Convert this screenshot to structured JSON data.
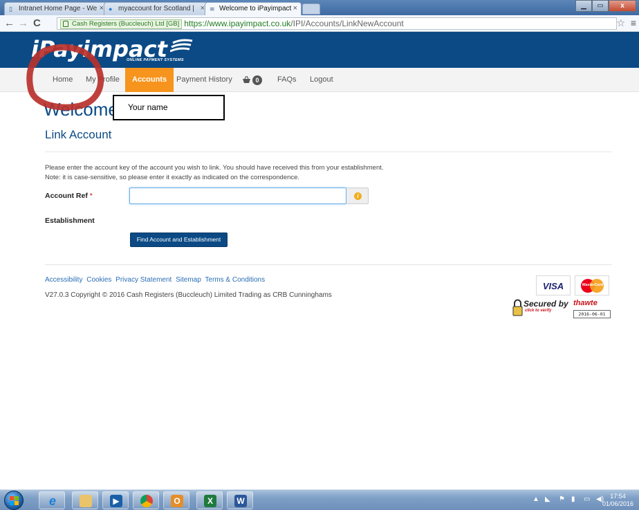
{
  "browser": {
    "tabs": [
      {
        "title": "Intranet Home Page - We",
        "close": "×"
      },
      {
        "title": "myaccount for Scotland |",
        "close": "×"
      },
      {
        "title": "Welcome to iPayimpact",
        "close": "×"
      }
    ],
    "cert_label": "Cash Registers (Buccleuch) Ltd [GB]",
    "url_host": "https://www.ipayimpact.co.uk",
    "url_path": "/IPI/Accounts/LinkNewAccount",
    "window_buttons": [
      "▁",
      "▭",
      "x"
    ]
  },
  "site": {
    "logo": "iPayimpact",
    "logo_sub": "ONLINE PAYMENT SYSTEMS"
  },
  "nav": {
    "home": "Home",
    "profile": "My Profile",
    "accounts": "Accounts",
    "payment_history": "Payment History",
    "basket_count": "0",
    "faqs": "FAQs",
    "logout": "Logout"
  },
  "main": {
    "welcome": "Welcome",
    "name_box": "Your name",
    "title": "Link Account",
    "instr1": "Please enter the account key of the account you wish to link. You should have received this from your establishment.",
    "instr2": "Note: it is case-sensitive, so please enter it exactly as indicated on the correspondence.",
    "account_ref_label": "Account Ref",
    "required_marker": "*",
    "account_ref_value": "",
    "establishment_label": "Establishment",
    "find_button": "Find Account and Establishment"
  },
  "footer": {
    "links": [
      "Accessibility",
      "Cookies",
      "Privacy Statement",
      "Sitemap",
      "Terms & Conditions"
    ],
    "copyright": "V27.0.3 Copyright © 2016 Cash Registers (Buccleuch) Limited Trading as CRB Cunninghams",
    "visa": "VISA",
    "mastercard": "MasterCard",
    "seal_secured": "Secured by",
    "seal_thawte": "thawte",
    "seal_verify": "click to verify",
    "seal_date": "2016-06-01"
  },
  "taskbar": {
    "time": "17:54",
    "date": "01/06/2016"
  },
  "colors": {
    "brand_blue": "#0b4a85",
    "accent_orange": "#f7941d",
    "link_blue": "#2a6db5",
    "annotation_red": "#b8312c"
  }
}
